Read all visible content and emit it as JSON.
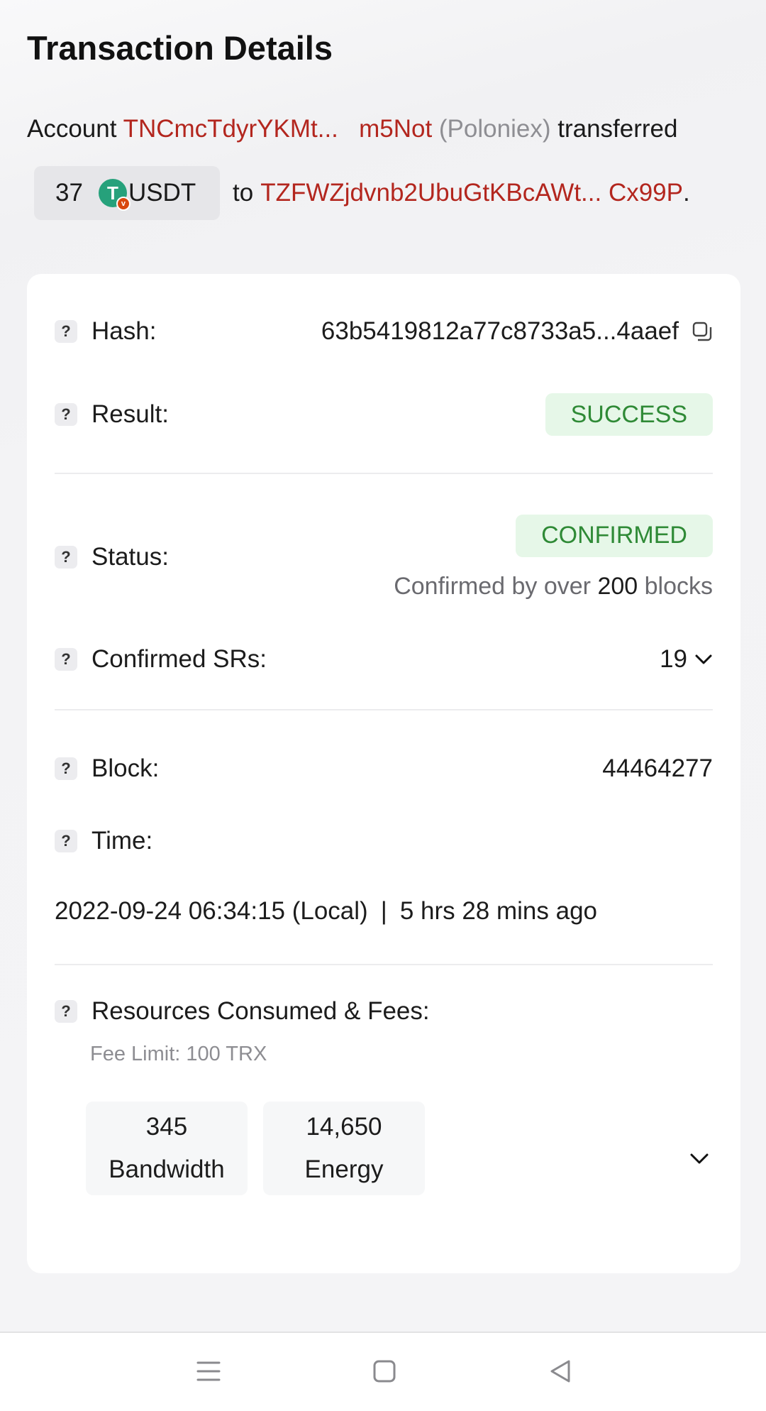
{
  "header": {
    "title": "Transaction Details"
  },
  "summary": {
    "account_word": "Account",
    "from_addr_start": "TNCmcTdyrYKMt...",
    "from_addr_end": "m5Not",
    "from_tag": "(Poloniex)",
    "verb": "transferred",
    "amount": "37",
    "token": "USDT",
    "token_logo_letter": "T",
    "token_badge": "v",
    "to_word": "to",
    "to_addr": "TZFWZjdvnb2UbuGtKBcAWt... Cx99P",
    "period": "."
  },
  "details": {
    "hash": {
      "label": "Hash:",
      "value": "63b5419812a77c8733a5...4aaef"
    },
    "result": {
      "label": "Result:",
      "value": "SUCCESS"
    },
    "status": {
      "label": "Status:",
      "value": "CONFIRMED",
      "note_prefix": "Confirmed by over",
      "note_count": "200",
      "note_suffix": "blocks"
    },
    "confirmed_srs": {
      "label": "Confirmed SRs:",
      "value": "19"
    },
    "block": {
      "label": "Block:",
      "value": "44464277"
    },
    "time": {
      "label": "Time:",
      "local": "2022-09-24 06:34:15 (Local)",
      "separator": "|",
      "relative": "5 hrs 28 mins ago"
    },
    "resources": {
      "label": "Resources Consumed & Fees:",
      "fee_limit": "Fee Limit: 100 TRX",
      "items": [
        {
          "value": "345",
          "name": "Bandwidth"
        },
        {
          "value": "14,650",
          "name": "Energy"
        }
      ]
    },
    "help_glyph": "?"
  },
  "icons": {
    "copy": "copy-icon",
    "chevron": "chevron-down-icon",
    "nav": [
      "menu-icon",
      "home-square-icon",
      "back-triangle-icon"
    ]
  },
  "colors": {
    "address": "#b3261e",
    "success_bg": "#e6f7e8",
    "success_text": "#2f8a36",
    "usdt": "#26a17b"
  }
}
